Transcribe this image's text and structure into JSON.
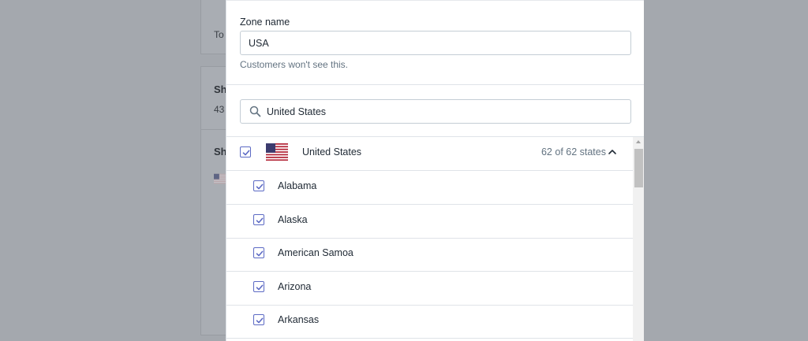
{
  "background": {
    "card1_text": "To",
    "card2_heading": "Sh",
    "card2_sub": "43",
    "card3_heading": "Sh"
  },
  "modal": {
    "zone_name_label": "Zone name",
    "zone_name_value": "USA",
    "zone_name_help": "Customers won't see this.",
    "search_value": "United States",
    "country": {
      "name": "United States",
      "state_count": "62 of 62 states",
      "checked": true,
      "flag_icon": "us-flag-icon"
    },
    "states": [
      {
        "name": "Alabama",
        "checked": true
      },
      {
        "name": "Alaska",
        "checked": true
      },
      {
        "name": "American Samoa",
        "checked": true
      },
      {
        "name": "Arizona",
        "checked": true
      },
      {
        "name": "Arkansas",
        "checked": true
      }
    ]
  },
  "colors": {
    "accent": "#5c6ac4",
    "overlay": "#a4a8ae",
    "border": "#dfe3e8",
    "muted_text": "#637381"
  }
}
